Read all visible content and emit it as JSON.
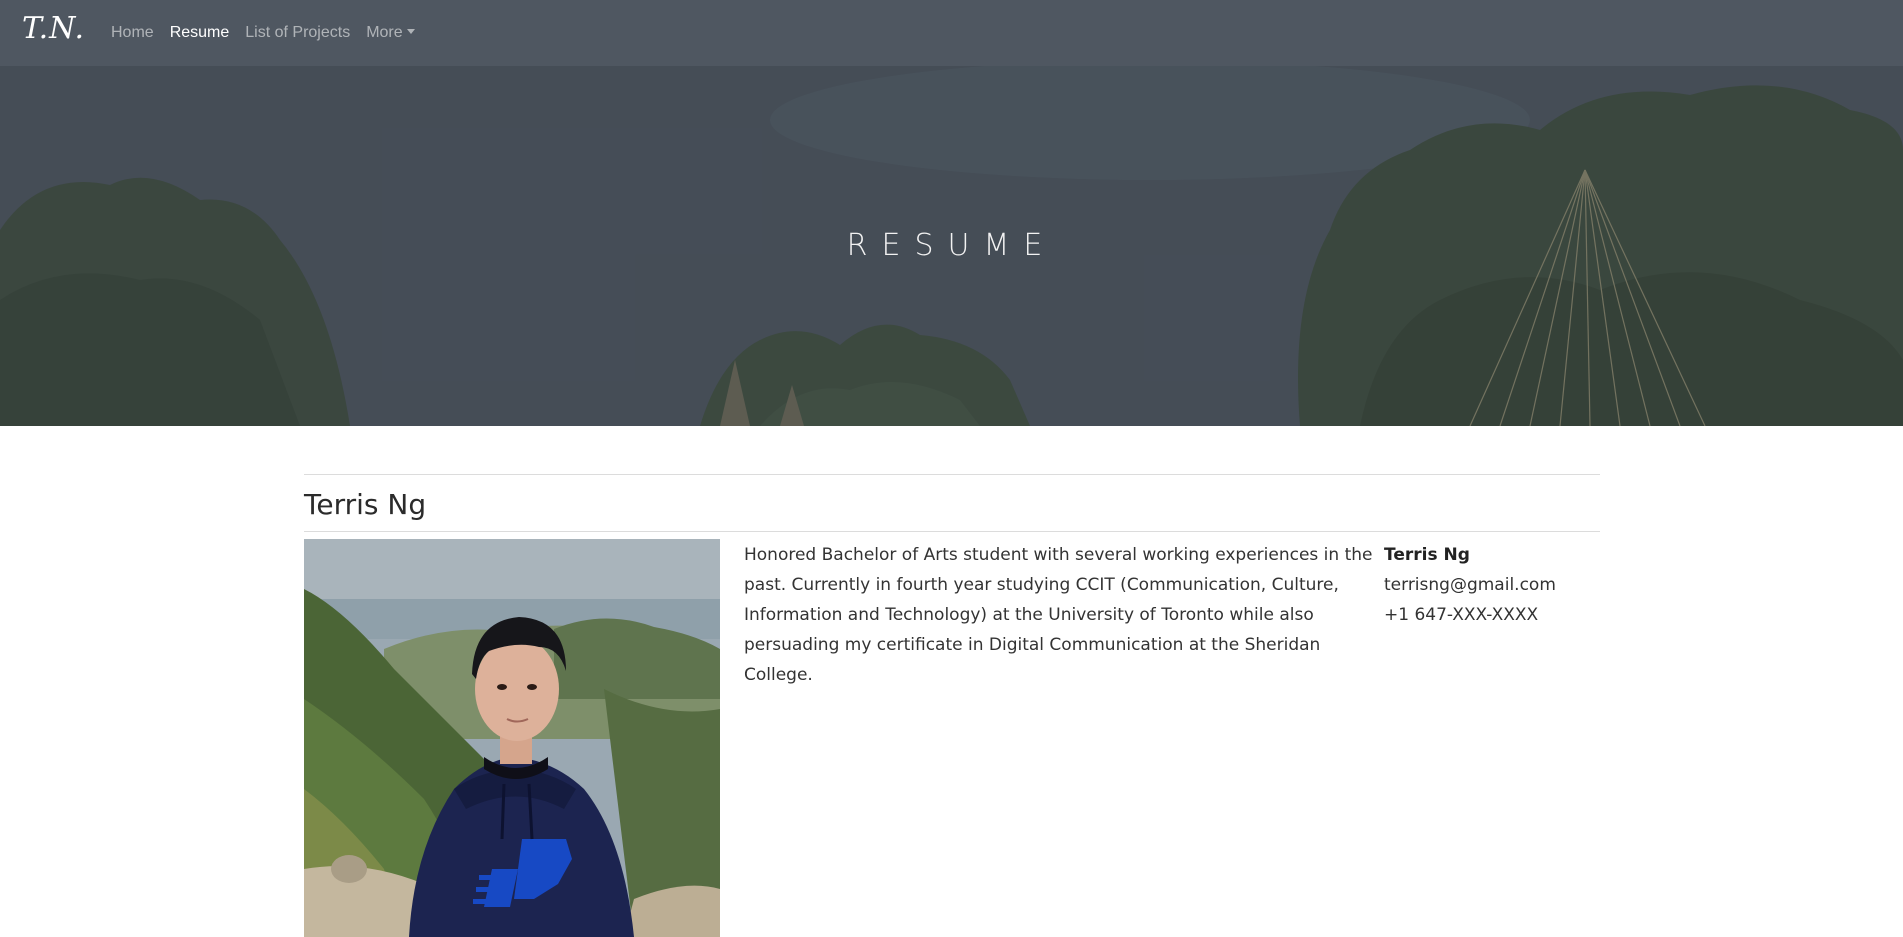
{
  "nav": {
    "brand": "T.N.",
    "links": [
      {
        "label": "Home",
        "active": false
      },
      {
        "label": "Resume",
        "active": true
      },
      {
        "label": "List of Projects",
        "active": false
      },
      {
        "label": "More",
        "active": false,
        "dropdown": true
      }
    ]
  },
  "hero": {
    "title": "RESUME"
  },
  "profile": {
    "name": "Terris Ng",
    "bio": "Honored Bachelor of Arts student with several working experiences in the past. Currently in fourth year studying CCIT (Communication, Culture, Information and Technology) at the University of Toronto while also persuading my certificate in Digital Communication at the Sheridan College.",
    "contact": {
      "name": "Terris Ng",
      "email": "terrisng@gmail.com",
      "phone": "+1 647-XXX-XXXX"
    },
    "photo_icon": "profile-photo"
  },
  "colors": {
    "navbar": "#505862",
    "nav_active": "#ffffff",
    "nav_inactive": "#a5a9ae",
    "hoodie": "#1c2450",
    "logo_blue": "#1749c4"
  }
}
